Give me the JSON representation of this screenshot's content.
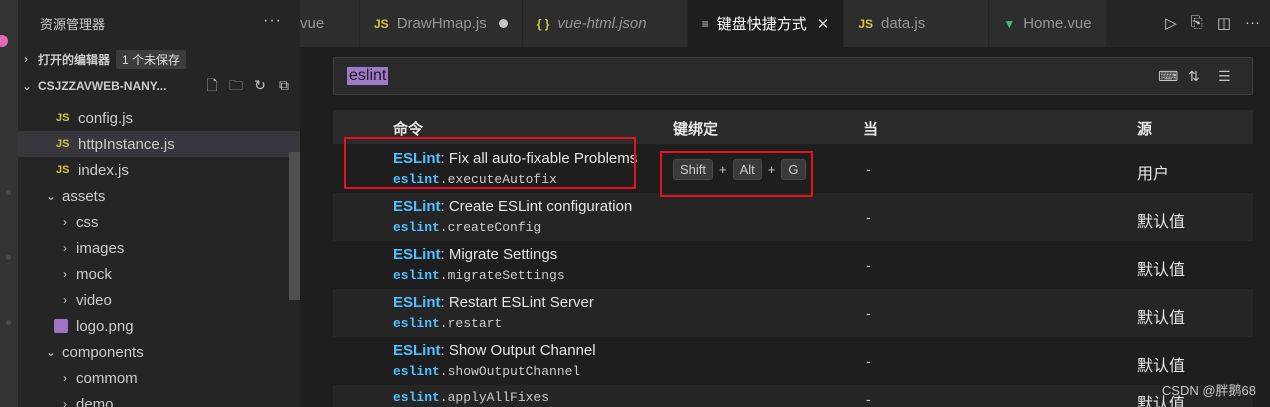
{
  "sidebar": {
    "title": "资源管理器",
    "open_editors_label": "打开的编辑器",
    "unsaved_badge": "1 个未保存",
    "project_name": "CSJZZAVWEB-NANY...",
    "tree": [
      {
        "type": "js",
        "label": "config.js"
      },
      {
        "type": "js",
        "label": "httpInstance.js",
        "selected": true
      },
      {
        "type": "js",
        "label": "index.js"
      },
      {
        "type": "folder-open",
        "label": "assets"
      },
      {
        "type": "folder",
        "label": "css"
      },
      {
        "type": "folder",
        "label": "images"
      },
      {
        "type": "folder",
        "label": "mock"
      },
      {
        "type": "folder",
        "label": "video"
      },
      {
        "type": "image",
        "label": "logo.png"
      },
      {
        "type": "folder-open",
        "label": "components"
      },
      {
        "type": "folder",
        "label": "commom"
      },
      {
        "type": "folder",
        "label": "demo"
      }
    ]
  },
  "tabs": [
    {
      "label": "vue",
      "icon": "vue-icon"
    },
    {
      "label": "DrawHmap.js",
      "icon_text": "JS",
      "modified": true
    },
    {
      "label": "vue-html.json",
      "icon_text": "{ }",
      "italic": true
    },
    {
      "label": "键盘快捷方式",
      "icon_text": "≡",
      "active": true
    },
    {
      "label": "data.js",
      "icon_text": "JS"
    },
    {
      "label": "Home.vue",
      "icon_text": "▼"
    }
  ],
  "keybindings": {
    "search_value": "eslint",
    "columns": {
      "command": "命令",
      "keybinding": "键绑定",
      "when": "当",
      "source": "源"
    },
    "rows": [
      {
        "ext": "ESLint",
        "title": ": Fix all auto-fixable Problems",
        "cmd_prefix": "eslint",
        "cmd_rest": ".executeAutofix",
        "keys": [
          "Shift",
          "Alt",
          "G"
        ],
        "when": "-",
        "source": "用户"
      },
      {
        "ext": "ESLint",
        "title": ": Create ESLint configuration",
        "cmd_prefix": "eslint",
        "cmd_rest": ".createConfig",
        "keys": [],
        "when": "-",
        "source": "默认值"
      },
      {
        "ext": "ESLint",
        "title": ": Migrate Settings",
        "cmd_prefix": "eslint",
        "cmd_rest": ".migrateSettings",
        "keys": [],
        "when": "-",
        "source": "默认值"
      },
      {
        "ext": "ESLint",
        "title": ": Restart ESLint Server",
        "cmd_prefix": "eslint",
        "cmd_rest": ".restart",
        "keys": [],
        "when": "-",
        "source": "默认值"
      },
      {
        "ext": "ESLint",
        "title": ": Show Output Channel",
        "cmd_prefix": "eslint",
        "cmd_rest": ".showOutputChannel",
        "keys": [],
        "when": "-",
        "source": "默认值"
      },
      {
        "ext": "",
        "title": "",
        "cmd_prefix": "eslint",
        "cmd_rest": ".applyAllFixes",
        "keys": [],
        "when": "-",
        "source": "默认值"
      }
    ]
  },
  "watermark": "CSDN @胖鹅68",
  "colors": {
    "highlight": "#e81123",
    "accent": "#4fc1ff",
    "search_selection": "#9e78c9"
  }
}
